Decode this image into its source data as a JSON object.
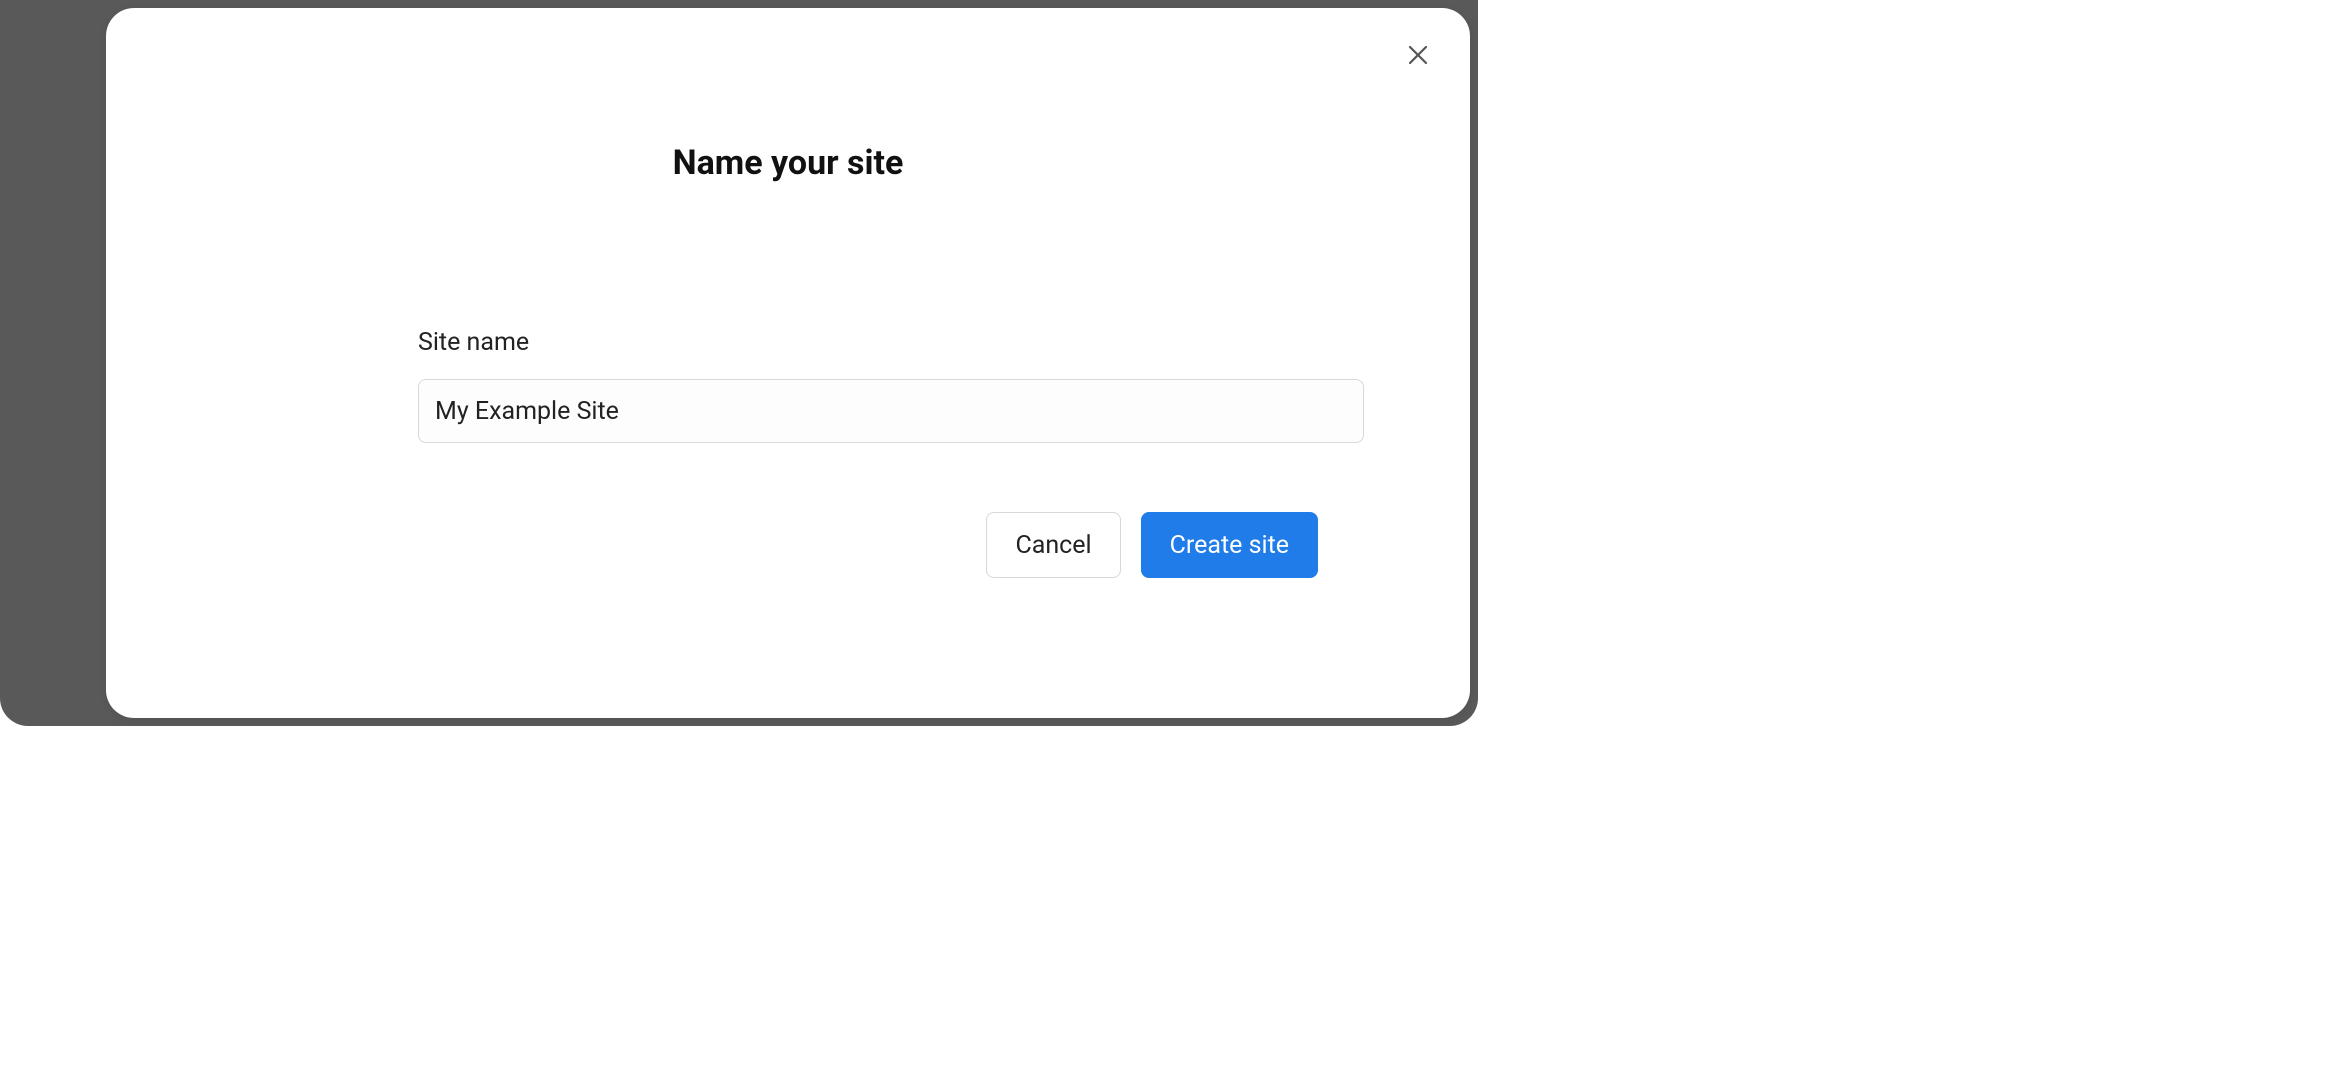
{
  "modal": {
    "title": "Name your site",
    "close_icon": "close-icon",
    "field": {
      "label": "Site name",
      "value": "My Example Site",
      "placeholder": ""
    },
    "buttons": {
      "cancel_label": "Cancel",
      "submit_label": "Create site"
    },
    "colors": {
      "primary": "#1f7ce8",
      "text": "#222222",
      "border": "#d8d8d8",
      "frame": "#595959"
    }
  }
}
